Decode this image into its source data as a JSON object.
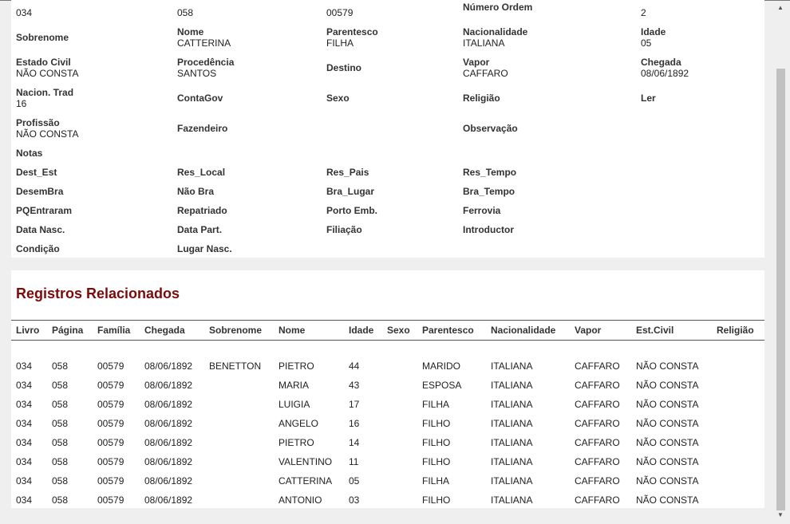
{
  "details": {
    "row0": {
      "livro": "034",
      "pagina": "058",
      "familia": "00579",
      "numero_ordem_label": "Número Ordem",
      "numero_ordem": "2"
    },
    "sobrenome_label": "Sobrenome",
    "nome_label": "Nome",
    "nome": "CATTERINA",
    "parentesco_label": "Parentesco",
    "parentesco": "FILHA",
    "nacionalidade_label": "Nacionalidade",
    "nacionalidade": "ITALIANA",
    "idade_label": "Idade",
    "idade": "05",
    "estado_civil_label": "Estado Civil",
    "estado_civil": "NÃO CONSTA",
    "procedencia_label": "Procedência",
    "procedencia": "SANTOS",
    "destino_label": "Destino",
    "vapor_label": "Vapor",
    "vapor": "CAFFARO",
    "chegada_label": "Chegada",
    "chegada": "08/06/1892",
    "nacion_trad_label": "Nacion. Trad",
    "nacion_trad": "16",
    "contagov_label": "ContaGov",
    "sexo_label": "Sexo",
    "religiao_label": "Religião",
    "ler_label": "Ler",
    "profissao_label": "Profissão",
    "profissao": "NÃO CONSTA",
    "fazendeiro_label": "Fazendeiro",
    "observacao_label": "Observação",
    "notas_label": "Notas",
    "dest_est_label": "Dest_Est",
    "res_local_label": "Res_Local",
    "res_pais_label": "Res_Pais",
    "res_tempo_label": "Res_Tempo",
    "desembra_label": "DesemBra",
    "nao_bra_label": "Não Bra",
    "bra_lugar_label": "Bra_Lugar",
    "bra_tempo_label": "Bra_Tempo",
    "pqentraram_label": "PQEntraram",
    "repatriado_label": "Repatriado",
    "porto_emb_label": "Porto Emb.",
    "ferrovia_label": "Ferrovia",
    "data_nasc_label": "Data Nasc.",
    "data_part_label": "Data Part.",
    "filiacao_label": "Filiação",
    "introductor_label": "Introductor",
    "condicao_label": "Condição",
    "lugar_nasc_label": "Lugar Nasc."
  },
  "related": {
    "title": "Registros Relacionados",
    "columns": [
      "Livro",
      "Página",
      "Família",
      "Chegada",
      "Sobrenome",
      "Nome",
      "Idade",
      "Sexo",
      "Parentesco",
      "Nacionalidade",
      "Vapor",
      "Est.Civil",
      "Religião"
    ],
    "rows": [
      [
        "034",
        "058",
        "00579",
        "08/06/1892",
        "BENETTON",
        "PIETRO",
        "44",
        "",
        "MARIDO",
        "ITALIANA",
        "CAFFARO",
        "NÃO CONSTA",
        ""
      ],
      [
        "034",
        "058",
        "00579",
        "08/06/1892",
        "",
        "MARIA",
        "43",
        "",
        "ESPOSA",
        "ITALIANA",
        "CAFFARO",
        "NÃO CONSTA",
        ""
      ],
      [
        "034",
        "058",
        "00579",
        "08/06/1892",
        "",
        "LUIGIA",
        "17",
        "",
        "FILHA",
        "ITALIANA",
        "CAFFARO",
        "NÃO CONSTA",
        ""
      ],
      [
        "034",
        "058",
        "00579",
        "08/06/1892",
        "",
        "ANGELO",
        "16",
        "",
        "FILHO",
        "ITALIANA",
        "CAFFARO",
        "NÃO CONSTA",
        ""
      ],
      [
        "034",
        "058",
        "00579",
        "08/06/1892",
        "",
        "PIETRO",
        "14",
        "",
        "FILHO",
        "ITALIANA",
        "CAFFARO",
        "NÃO CONSTA",
        ""
      ],
      [
        "034",
        "058",
        "00579",
        "08/06/1892",
        "",
        "VALENTINO",
        "11",
        "",
        "FILHO",
        "ITALIANA",
        "CAFFARO",
        "NÃO CONSTA",
        ""
      ],
      [
        "034",
        "058",
        "00579",
        "08/06/1892",
        "",
        "CATTERINA",
        "05",
        "",
        "FILHA",
        "ITALIANA",
        "CAFFARO",
        "NÃO CONSTA",
        ""
      ],
      [
        "034",
        "058",
        "00579",
        "08/06/1892",
        "",
        "ANTONIO",
        "03",
        "",
        "FILHO",
        "ITALIANA",
        "CAFFARO",
        "NÃO CONSTA",
        ""
      ]
    ]
  },
  "scrollbar": {
    "up_icon": "triangle-up-icon",
    "down_icon": "triangle-down-icon"
  }
}
